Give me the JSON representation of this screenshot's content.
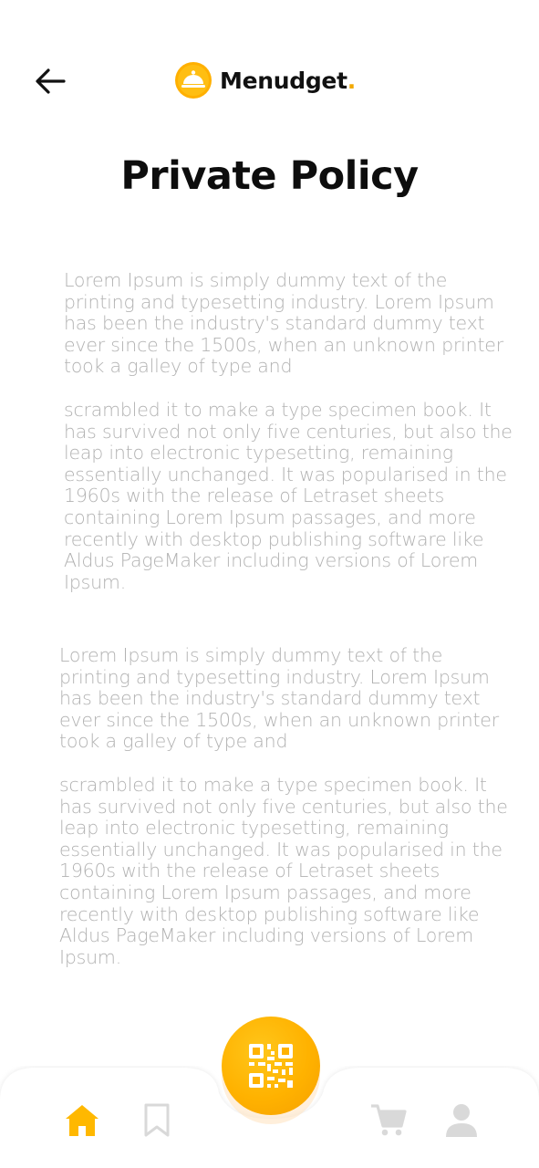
{
  "header": {
    "back_icon": "arrow-left-icon",
    "brand_icon": "cloche-icon",
    "brand_name": "Menudget",
    "brand_dot": ".",
    "brand_color": "#f2a900"
  },
  "page": {
    "title": "Private Policy"
  },
  "content": {
    "paragraphs": [
      "Lorem Ipsum is simply dummy text of the printing and typesetting industry. Lorem Ipsum has been the industry's standard dummy text ever since the 1500s, when an unknown printer took a galley of type and",
      "scrambled it to make a type specimen book. It has survived not only five centuries, but also the leap into electronic typesetting, remaining essentially unchanged. It was popularised in the 1960s with the release of Letraset sheets containing Lorem Ipsum passages, and more recently with desktop publishing software like Aldus PageMaker including versions of Lorem Ipsum.",
      "Lorem Ipsum is simply dummy text of the printing and typesetting industry. Lorem Ipsum has been the industry's standard dummy text ever since the 1500s, when an unknown printer took a galley of type and",
      "scrambled it to make a type specimen book. It has survived not only five centuries, but also the leap into electronic typesetting, remaining essentially unchanged. It was popularised in the 1960s with the release of Letraset sheets containing Lorem Ipsum passages, and more recently with desktop publishing software like Aldus PageMaker including versions of Lorem Ipsum."
    ]
  },
  "bottom_nav": {
    "active_color": "#ffb800",
    "inactive_color": "#d9d9d9",
    "items": [
      {
        "icon": "home-icon",
        "active": true
      },
      {
        "icon": "bookmark-icon",
        "active": false
      },
      {
        "icon": "qr-code-icon",
        "active": true
      },
      {
        "icon": "cart-icon",
        "active": false
      },
      {
        "icon": "user-icon",
        "active": false
      }
    ]
  }
}
